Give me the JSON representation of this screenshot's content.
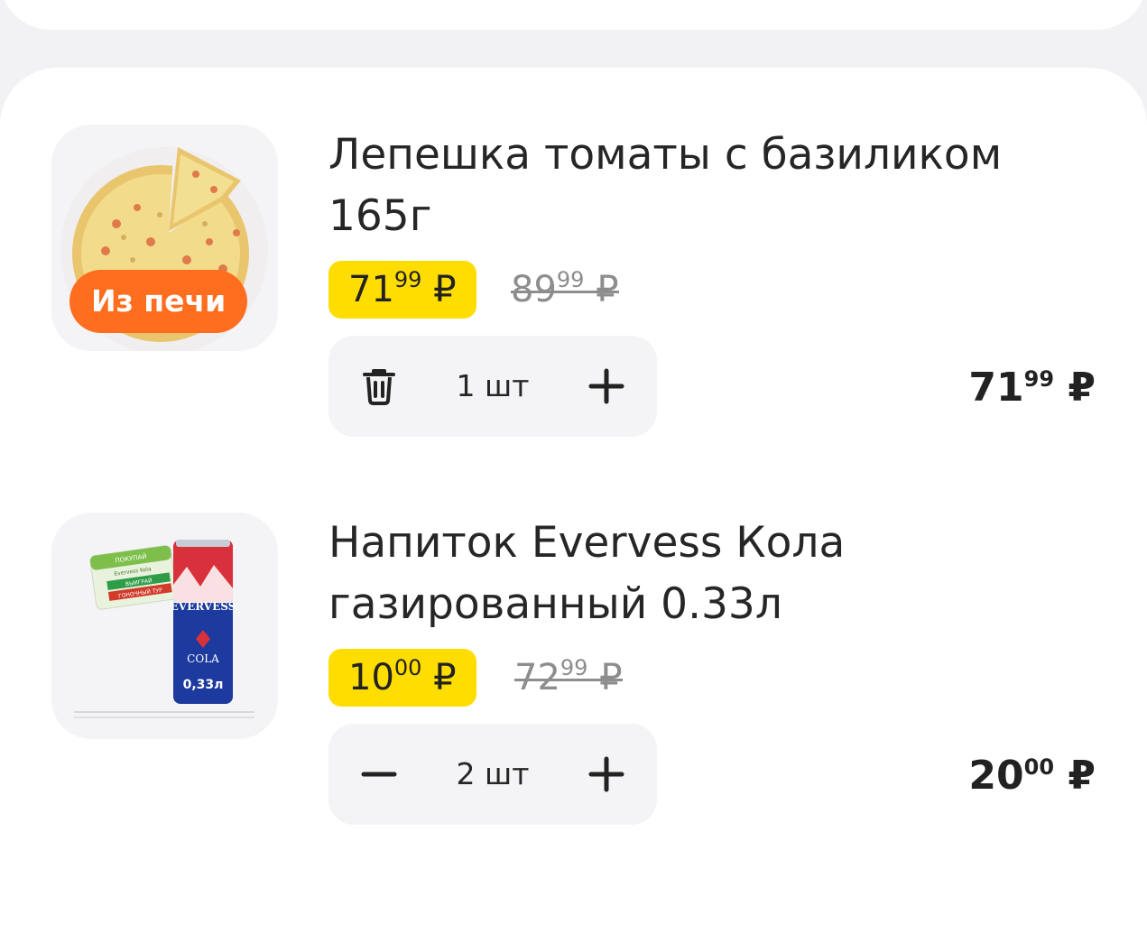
{
  "items": [
    {
      "title": "Лепешка томаты с базиликом 165г",
      "badge": "Из печи",
      "price_main": "71",
      "price_cents": "99",
      "old_price_main": "89",
      "old_price_cents": "99",
      "currency": "₽",
      "quantity": "1 шт",
      "left_action_icon": "trash-icon",
      "right_action_icon": "plus-icon",
      "total_main": "71",
      "total_cents": "99"
    },
    {
      "title": "Напиток Evervess Кола газированный 0.33л",
      "price_main": "10",
      "price_cents": "00",
      "old_price_main": "72",
      "old_price_cents": "99",
      "currency": "₽",
      "quantity": "2 шт",
      "left_action_icon": "minus-icon",
      "right_action_icon": "plus-icon",
      "total_main": "20",
      "total_cents": "00",
      "product_image_text": {
        "brand": "EVERVESS",
        "flavor": "COLA",
        "volume": "0,33л",
        "promo_card": [
          "ПОКУПАЙ",
          "Evervess Kola",
          "ВЫИГРАЙ",
          "ГОНОЧНЫЙ ТУР"
        ]
      }
    }
  ],
  "colors": {
    "price_tag": "#ffdd00",
    "badge": "#ff6d1f",
    "background": "#f2f2f4"
  }
}
